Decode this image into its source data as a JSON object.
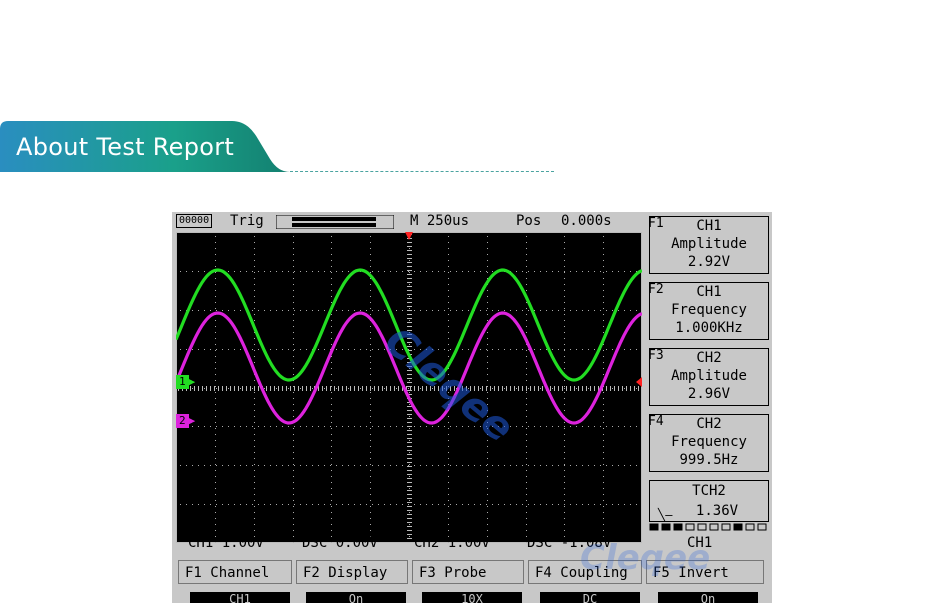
{
  "header": {
    "title": "About Test Report"
  },
  "scope": {
    "battery": "00000",
    "trig_label": "Trig",
    "timebase": "M 250us",
    "pos_label": "Pos",
    "pos_value": "0.000s",
    "measurements": [
      {
        "num": "F1",
        "channel": "CH1",
        "type": "Amplitude",
        "value": "2.92V"
      },
      {
        "num": "F2",
        "channel": "CH1",
        "type": "Frequency",
        "value": "1.000KHz"
      },
      {
        "num": "F3",
        "channel": "CH2",
        "type": "Amplitude",
        "value": "2.96V"
      },
      {
        "num": "F4",
        "channel": "CH2",
        "type": "Frequency",
        "value": "999.5Hz"
      }
    ],
    "trigger": {
      "label": "TCH2",
      "value": "1.36V"
    },
    "status": {
      "ch1": "CH1 1.00V",
      "dsc1": "DSC  0.00V",
      "ch2": "CH2 1.00V",
      "dsc2": "DSC -1.08V",
      "active_channel": "CH1"
    },
    "menu": [
      {
        "label": "F1 Channel",
        "value": "CH1"
      },
      {
        "label": "F2 Display",
        "value": "On"
      },
      {
        "label": "F3  Probe",
        "value": "10X"
      },
      {
        "label": "F4 Coupling",
        "value": "DC"
      },
      {
        "label": "F5 Invert",
        "value": "On"
      }
    ],
    "channel_markers": {
      "ch1": "1",
      "ch2": "2"
    },
    "traces": [
      {
        "name": "CH1",
        "color": "#22dd22"
      },
      {
        "name": "CH2",
        "color": "#dd22dd"
      }
    ],
    "watermark": "Cleqee",
    "colors": {
      "banner_start": "#2a8ec0",
      "banner_end": "#1aa08a"
    }
  }
}
